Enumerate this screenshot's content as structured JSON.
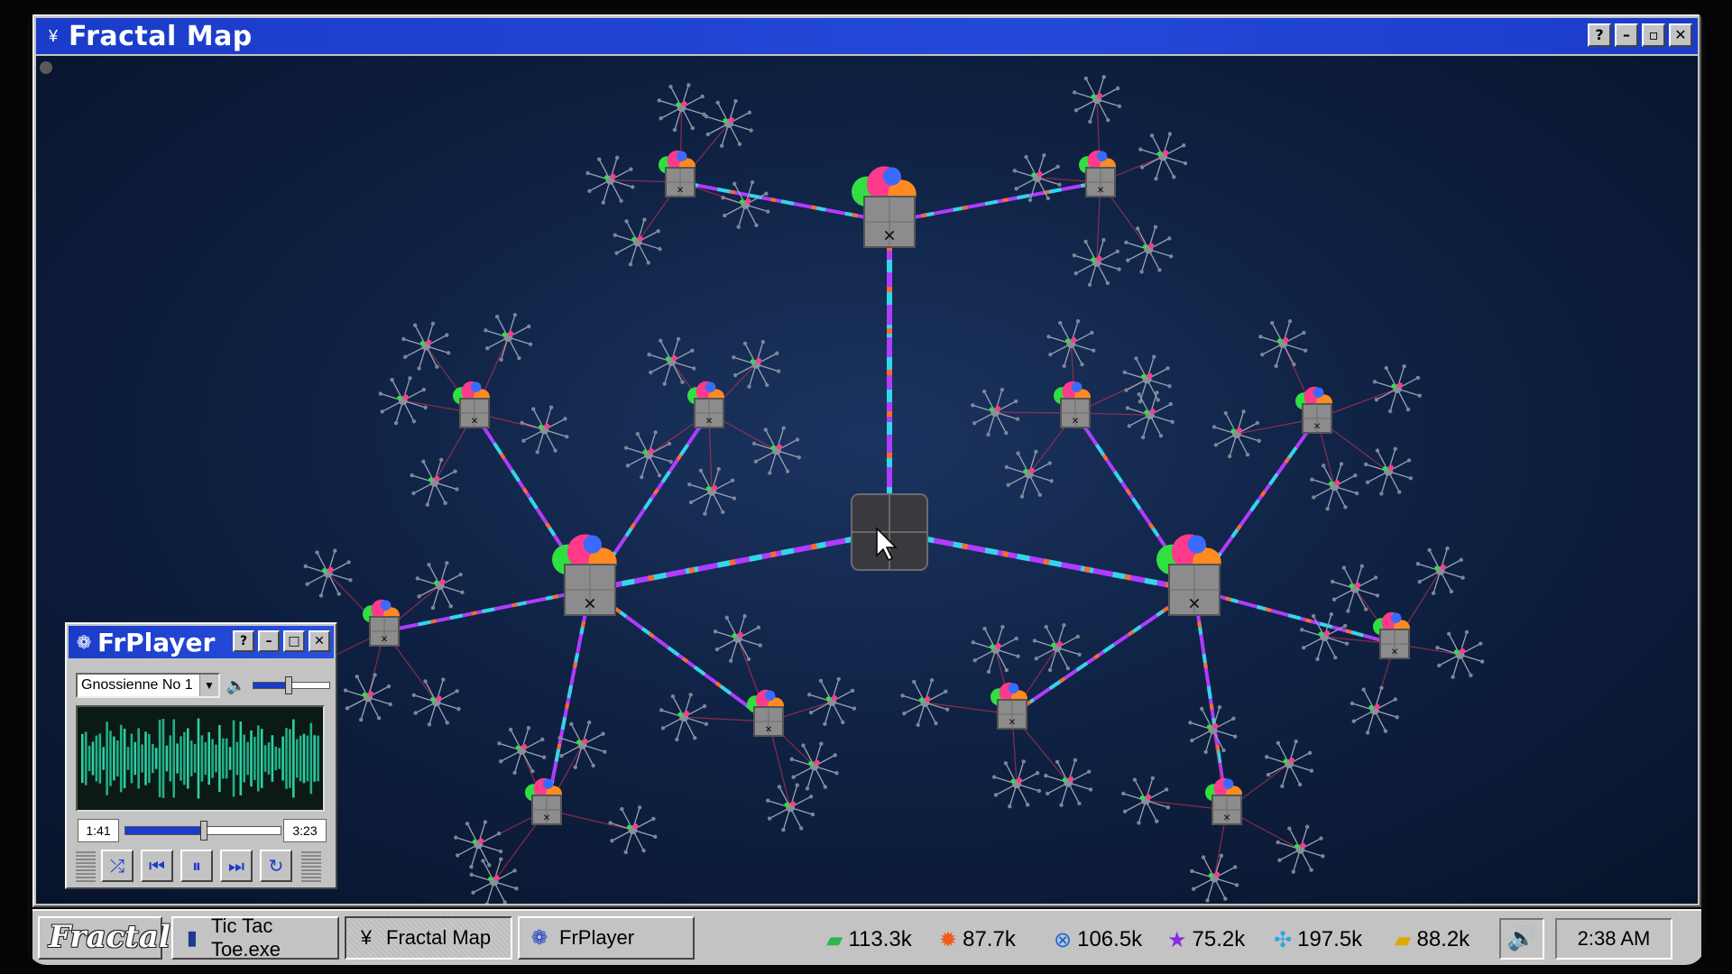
{
  "window": {
    "title": "Fractal Map",
    "icon": "tree-icon",
    "controls": [
      "?",
      "–",
      "▫",
      "✕"
    ]
  },
  "map": {
    "center_node": "hub",
    "node_marker": "✕"
  },
  "player": {
    "title": "FrPlayer",
    "track": "Gnossienne No 1",
    "current_time": "1:41",
    "total_time": "3:23",
    "progress": 0.5,
    "volume": 0.45,
    "buttons": {
      "shuffle": "⤮",
      "prev": "⏮",
      "pause": "⏸",
      "next": "⏭",
      "repeat": "↻"
    }
  },
  "taskbar": {
    "start_label": "Fractal",
    "tasks": [
      {
        "label": "Tic Tac Toe.exe",
        "icon": "book-icon"
      },
      {
        "label": "Fractal Map",
        "icon": "tree-icon"
      },
      {
        "label": "FrPlayer",
        "icon": "player-icon"
      }
    ],
    "resources": [
      {
        "value": "113.3k",
        "icon": "money-icon",
        "color": "#2db84a"
      },
      {
        "value": "87.7k",
        "icon": "fire-icon",
        "color": "#f05a1a"
      },
      {
        "value": "106.5k",
        "icon": "blue-x-icon",
        "color": "#1a6ad8"
      },
      {
        "value": "75.2k",
        "icon": "star-icon",
        "color": "#8a2be2"
      },
      {
        "value": "197.5k",
        "icon": "compass-icon",
        "color": "#2aa8e0"
      },
      {
        "value": "88.2k",
        "icon": "gold-icon",
        "color": "#e0a800"
      }
    ],
    "clock": "2:38 AM"
  },
  "colors": {
    "titlebar": "#1a3cc8",
    "link_a": "#b03cff",
    "link_b": "#30d8e8",
    "link_c": "#ff6a2a"
  }
}
